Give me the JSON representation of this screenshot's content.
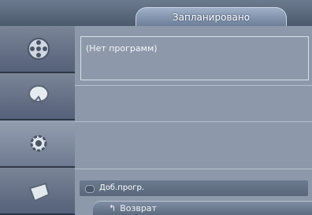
{
  "title": "Запланировано",
  "list": {
    "empty_text": "(Нет программ)"
  },
  "add_program": {
    "label": "Доб.прогр."
  },
  "footer": {
    "return_label": "Возврат",
    "return_icon": "return-icon"
  },
  "sidebar": {
    "icons": [
      "film-reel-icon",
      "satellite-dish-icon",
      "gear-icon",
      "input-plug-icon"
    ]
  },
  "colors": {
    "frame": "#7d8a9c",
    "content": "#8d99aa",
    "accent": "#6c7f99"
  }
}
